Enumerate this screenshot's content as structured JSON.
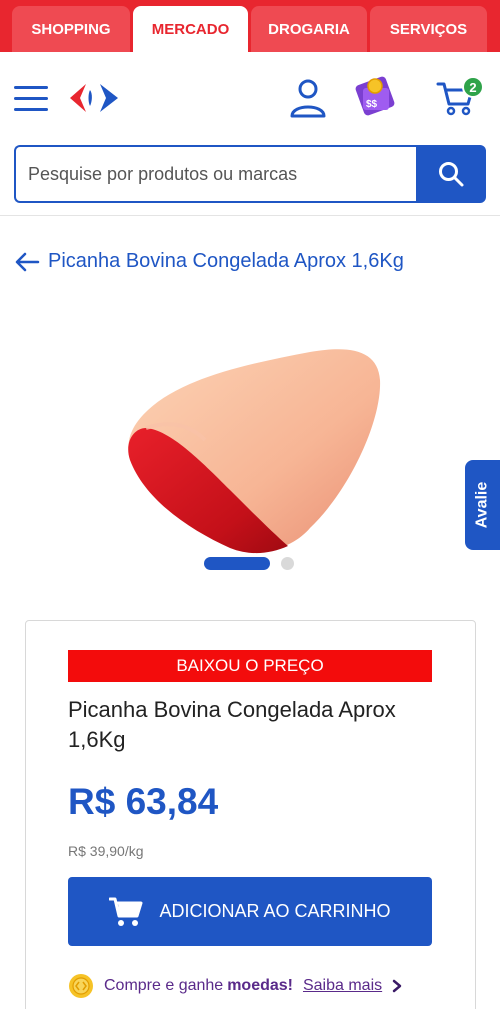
{
  "tabs": [
    {
      "label": "SHOPPING",
      "active": false
    },
    {
      "label": "MERCADO",
      "active": true
    },
    {
      "label": "DROGARIA",
      "active": false
    },
    {
      "label": "SERVIÇOS",
      "active": false
    }
  ],
  "header": {
    "cart_count": "2"
  },
  "search": {
    "placeholder": "Pesquise por produtos ou marcas"
  },
  "breadcrumb": {
    "title": "Picanha Bovina Congelada Aprox 1,6Kg"
  },
  "side_tab": {
    "label": "Avalie"
  },
  "carousel": {
    "current": 1,
    "total": 2
  },
  "product": {
    "badge": "BAIXOU O PREÇO",
    "title": "Picanha Bovina Congelada Aprox 1,6Kg",
    "price": "R$ 63,84",
    "unit_price": "R$ 39,90/kg",
    "add_to_cart": "ADICIONAR AO CARRINHO"
  },
  "coins": {
    "text": "Compre e ganhe",
    "strong": "moedas!",
    "link": "Saiba mais"
  },
  "colors": {
    "brand_red": "#e8262f",
    "brand_blue": "#1f56c4",
    "badge_red": "#f30c0c",
    "cart_badge_green": "#2fa34a",
    "coin_purple": "#5a2a8a"
  }
}
